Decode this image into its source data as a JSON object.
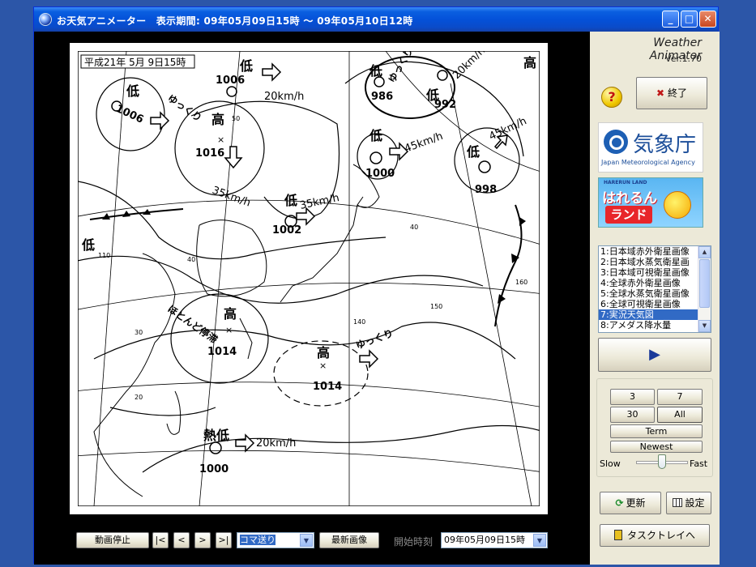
{
  "window": {
    "title": "お天気アニメーター　表示期間: 09年05月09日15時 ～ 09年05月10日12時",
    "controls": {
      "minimize": "_",
      "maximize": "□",
      "close": "✕"
    }
  },
  "map": {
    "date_label": "平成21年 5月 9日15時",
    "pressure_systems": [
      {
        "kind": "低",
        "pressure": "1006"
      },
      {
        "kind": "低",
        "pressure": "1006"
      },
      {
        "kind": "高",
        "pressure": "1016"
      },
      {
        "kind": "低",
        "pressure": "986"
      },
      {
        "kind": "低",
        "pressure": "992"
      },
      {
        "kind": "高",
        "pressure": ""
      },
      {
        "kind": "低",
        "pressure": "1000"
      },
      {
        "kind": "低",
        "pressure": "998"
      },
      {
        "kind": "低",
        "pressure": "1002"
      },
      {
        "kind": "低",
        "pressure": ""
      },
      {
        "kind": "高",
        "pressure": "1014"
      },
      {
        "kind": "高",
        "pressure": "1014"
      },
      {
        "kind": "熱低",
        "pressure": "1000"
      }
    ],
    "speed_labels": [
      "20km/h",
      "35km/h",
      "35km/h",
      "45km/h",
      "45km/h",
      "20km/h",
      "20km/h"
    ],
    "movement_labels": [
      "ゆっくり",
      "ゆっくり",
      "ゆっくり",
      "ほとんど停滞"
    ],
    "grid_labels": [
      "50",
      "40",
      "40",
      "30",
      "20",
      "140",
      "150",
      "160",
      "110"
    ]
  },
  "toolbar": {
    "stop_label": "動画停止",
    "first_label": "|<",
    "prev_label": "<",
    "next_label": ">",
    "last_label": ">|",
    "frame_mode": "コマ送り",
    "latest_label": "最新画像",
    "start_time_label": "開始時刻",
    "start_time_value": "09年05月09日15時"
  },
  "sidebar": {
    "app_name": "Weather Animator",
    "version": "Ver.1.70",
    "help_icon": "?",
    "exit_label": "終了",
    "jma_logo_text": "気象庁",
    "jma_logo_sub": "Japan Meteorological Agency",
    "harerun_top": "HARERUN LAND",
    "harerun_line1": "はれるん",
    "harerun_line2": "ランド",
    "list_items": [
      "1:日本域赤外衛星画像",
      "2:日本域水蒸気衛星画",
      "3:日本域可視衛星画像",
      "4:全球赤外衛星画像",
      "5:全球水蒸気衛星画像",
      "6:全球可視衛星画像",
      "7:実況天気図",
      "8:アメダス降水量"
    ],
    "selected_index": 6,
    "play_icon": "▶",
    "range_buttons": [
      "3",
      "7",
      "30",
      "All"
    ],
    "term_label": "Term",
    "newest_label": "Newest",
    "slow_label": "Slow",
    "fast_label": "Fast",
    "speed_level": 0.5,
    "refresh_label": "更新",
    "settings_label": "設定",
    "tray_label": "タスクトレイへ"
  },
  "colors": {
    "title_blue": "#0451d9",
    "select_blue": "#316ac5",
    "panel": "#ece9d8"
  }
}
